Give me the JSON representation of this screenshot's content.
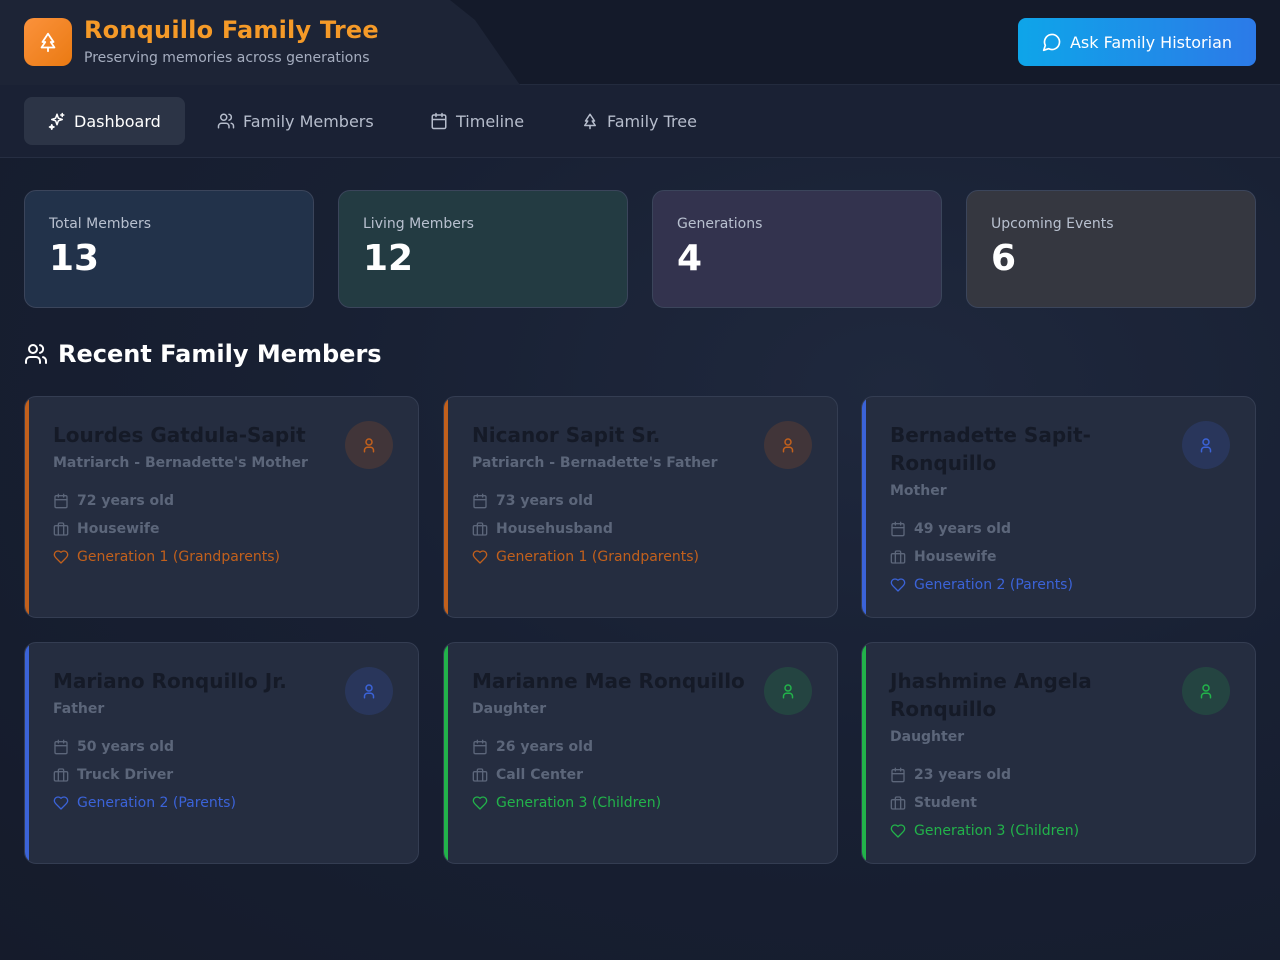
{
  "app": {
    "title": "Ronquillo Family Tree",
    "subtitle": "Preserving memories across generations",
    "ask_button_label": "Ask Family Historian",
    "brand_color": "#f59a28"
  },
  "nav": {
    "tabs": [
      {
        "label": "Dashboard",
        "icon": "sparkles-icon",
        "active": true
      },
      {
        "label": "Family Members",
        "icon": "users-icon",
        "active": false
      },
      {
        "label": "Timeline",
        "icon": "calendar-icon",
        "active": false
      },
      {
        "label": "Family Tree",
        "icon": "tree-icon",
        "active": false
      }
    ]
  },
  "stats": [
    {
      "label": "Total Members",
      "value": "13",
      "color": "#22324a"
    },
    {
      "label": "Living Members",
      "value": "12",
      "color": "#233b42"
    },
    {
      "label": "Generations",
      "value": "4",
      "color": "#33334e"
    },
    {
      "label": "Upcoming Events",
      "value": "6",
      "color": "#353740"
    }
  ],
  "recent": {
    "title": "Recent Family Members",
    "members": [
      {
        "name": "Lourdes Gatdula-Sapit",
        "role": "Matriarch - Bernadette's Mother",
        "age": "72 years old",
        "occupation": "Housewife",
        "generation": "Generation 1 (Grandparents)",
        "color": "#c2601c"
      },
      {
        "name": "Nicanor Sapit Sr.",
        "role": "Patriarch - Bernadette's Father",
        "age": "73 years old",
        "occupation": "Househusband",
        "generation": "Generation 1 (Grandparents)",
        "color": "#c2601c"
      },
      {
        "name": "Bernadette Sapit-Ronquillo",
        "role": "Mother",
        "age": "49 years old",
        "occupation": "Housewife",
        "generation": "Generation 2 (Parents)",
        "color": "#3b63d8"
      },
      {
        "name": "Mariano Ronquillo Jr.",
        "role": "Father",
        "age": "50 years old",
        "occupation": "Truck Driver",
        "generation": "Generation 2 (Parents)",
        "color": "#3b63d8"
      },
      {
        "name": "Marianne Mae Ronquillo",
        "role": "Daughter",
        "age": "26 years old",
        "occupation": "Call Center",
        "generation": "Generation 3 (Children)",
        "color": "#22b34a"
      },
      {
        "name": "Jhashmine Angela Ronquillo",
        "role": "Daughter",
        "age": "23 years old",
        "occupation": "Student",
        "generation": "Generation 3 (Children)",
        "color": "#22b34a"
      }
    ]
  }
}
